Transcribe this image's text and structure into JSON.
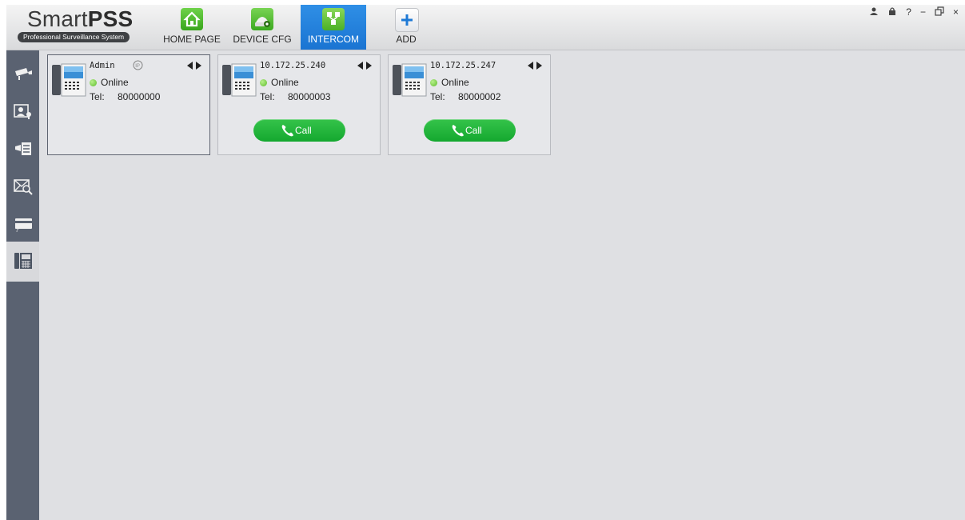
{
  "app": {
    "logo_main": "Smart",
    "logo_bold": "PSS",
    "tagline": "Professional Surveillance System"
  },
  "nav": [
    {
      "label": "HOME PAGE",
      "icon": "home-icon",
      "active": false
    },
    {
      "label": "DEVICE CFG",
      "icon": "device-config-icon",
      "active": false
    },
    {
      "label": "INTERCOM",
      "icon": "intercom-icon",
      "active": true
    },
    {
      "label": "ADD",
      "icon": "add-icon",
      "active": false
    }
  ],
  "window_controls": {
    "user": "user-icon",
    "lock": "lock-icon",
    "help": "?",
    "minimize": "−",
    "restore": "restore-icon",
    "close": "×"
  },
  "sidebar": [
    {
      "icon": "camera-icon",
      "active": false
    },
    {
      "icon": "video-talk-icon",
      "active": false
    },
    {
      "icon": "announcement-icon",
      "active": false
    },
    {
      "icon": "message-search-icon",
      "active": false
    },
    {
      "icon": "card-icon",
      "active": false
    },
    {
      "icon": "intercom-panel-icon",
      "active": true
    }
  ],
  "devices": [
    {
      "name": "Admin",
      "status": "Online",
      "tel_label": "Tel:",
      "tel": "80000000",
      "has_call": false,
      "has_ip_badge": true,
      "ip_badge_icon": "ip-phone-icon",
      "selected": true
    },
    {
      "name": "10.172.25.240",
      "status": "Online",
      "tel_label": "Tel:",
      "tel": "80000003",
      "has_call": true,
      "call_label": "Call",
      "selected": false
    },
    {
      "name": "10.172.25.247",
      "status": "Online",
      "tel_label": "Tel:",
      "tel": "80000002",
      "has_call": true,
      "call_label": "Call",
      "selected": false
    }
  ],
  "colors": {
    "nav_active": "#1a74d2",
    "sidebar_bg": "#5a6271",
    "online": "#5dbd2c",
    "call_button": "#14a82f"
  }
}
